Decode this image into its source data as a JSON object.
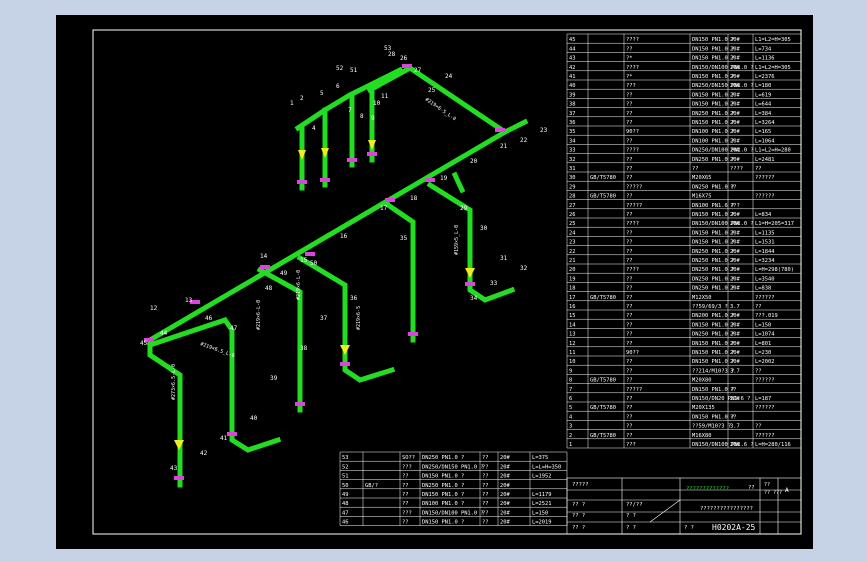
{
  "title_block": {
    "drawing_no": "H0202A-25",
    "row1": [
      "??",
      "??",
      "??\n???",
      "A"
    ],
    "row2": [
      "?? ?",
      "??/??",
      "????????????????"
    ],
    "row3": [
      "?? ?",
      "? ?"
    ],
    "row4": [
      "?? ?",
      "? ?",
      "? ?"
    ],
    "green_label": "?????????????",
    "left_cell": "?????"
  },
  "right_table": [
    [
      "45",
      "",
      "????",
      "DN150 PN1.0 ?",
      "20#",
      "L1=L2=H=305"
    ],
    [
      "44",
      "",
      "??",
      "DN150 PN1.0 ?",
      "20#",
      "L=734"
    ],
    [
      "43",
      "",
      "?*",
      "DN150 PN1.0 ?",
      "20#",
      "L=1136"
    ],
    [
      "42",
      "",
      "????",
      "DN150/DN100 PN1.0 ?",
      "20#",
      "L1=L2=H=305"
    ],
    [
      "41",
      "",
      "?*",
      "DN150 PN1.0 ?",
      "20#",
      "L=2376"
    ],
    [
      "40",
      "",
      "???",
      "DN250/DN150 PN1.0 ?",
      "20#",
      "L=180"
    ],
    [
      "39",
      "",
      "??",
      "DN150 PN1.0 ?",
      "20#",
      "L=619"
    ],
    [
      "38",
      "",
      "??",
      "DN150 PN1.0 ?",
      "20#",
      "L=644"
    ],
    [
      "37",
      "",
      "??",
      "DN250 PN1.0 ?",
      "20#",
      "L=384"
    ],
    [
      "36",
      "",
      "??",
      "DN150 PN1.0 ?",
      "20#",
      "L=3264"
    ],
    [
      "35",
      "",
      "90??",
      "DN100 PN1.0 ?",
      "20#",
      "L=165"
    ],
    [
      "34",
      "",
      "??",
      "DN100 PN1.0 ?",
      "20#",
      "L=1064"
    ],
    [
      "33",
      "",
      "????",
      "DN250/DN100 PN1.0 ?",
      "20#",
      "L1=L2=H=280"
    ],
    [
      "32",
      "",
      "??",
      "DN250 PN1.0 ?",
      "20#",
      "L=2481"
    ],
    [
      "31",
      "",
      "??",
      "??",
      "????",
      "??"
    ],
    [
      "30",
      "GB/T5780",
      "??",
      "M20X65",
      "",
      "4.8",
      "??????"
    ],
    [
      "29",
      "",
      "?????",
      "DN250 PN1.0 ?",
      "??",
      ""
    ],
    [
      "28",
      "GB/T5780",
      "??",
      "M16X75",
      "",
      "4.8",
      "??????"
    ],
    [
      "27",
      "",
      "?????",
      "DN100 PN1.6 ?",
      "???",
      ""
    ],
    [
      "26",
      "",
      "??",
      "DN150 PN1.0 ?",
      "20#",
      "L=834"
    ],
    [
      "25",
      "",
      "????",
      "DN150/DN100 PN1.0 ?",
      "20#",
      "L1=H=205=317"
    ],
    [
      "24",
      "",
      "??",
      "DN150 PN1.0 ?",
      "20#",
      "L=1135"
    ],
    [
      "23",
      "",
      "??",
      "DN150 PN1.0 ?",
      "20#",
      "L=1531"
    ],
    [
      "22",
      "",
      "??",
      "DN250 PN1.0 ?",
      "20#",
      "L=1844"
    ],
    [
      "21",
      "",
      "??",
      "DN250 PN1.0 ?",
      "20#",
      "L=3234"
    ],
    [
      "20",
      "",
      "????",
      "DN250 PN1.0 ?",
      "20#",
      "L=H=298(780)"
    ],
    [
      "19",
      "",
      "??",
      "DN250 PN1.0 ?",
      "20#",
      "L=3540"
    ],
    [
      "18",
      "",
      "??",
      "DN250 PN1.0 ?",
      "20#",
      "L=838"
    ],
    [
      "17",
      "GB/T5780",
      "??",
      "M12X50",
      "",
      "4.8",
      "??????"
    ],
    [
      "16",
      "",
      "??",
      "??59/69/3 ?",
      "3.7",
      "??"
    ],
    [
      "15",
      "",
      "??",
      "DN200 PN1.0 ?",
      "20#",
      "???.019"
    ],
    [
      "14",
      "",
      "??",
      "DN150 PN1.0 ?",
      "20#",
      "L=150"
    ],
    [
      "13",
      "",
      "??",
      "DN250 PN1.0 ?",
      "20#",
      "L=1074"
    ],
    [
      "12",
      "",
      "??",
      "DN150 PN1.0 ?",
      "20#",
      "L=801"
    ],
    [
      "11",
      "",
      "90??",
      "DN150 PN1.0 ?",
      "20#",
      "L=230"
    ],
    [
      "10",
      "",
      "??",
      "DN150 PN1.0 ?",
      "20#",
      "L=2002"
    ],
    [
      "9",
      "",
      "??",
      "??214/M10?3 ?",
      "3.7",
      "??"
    ],
    [
      "8",
      "GB/T5780",
      "??",
      "M20X80",
      "",
      "4.8",
      "??????"
    ],
    [
      "7",
      "",
      "?????",
      "DN150 PN1.0 ?",
      "??",
      ""
    ],
    [
      "6",
      "",
      "??",
      "DN150/DN20 PN1.6 ?",
      "20#",
      "L=187"
    ],
    [
      "5",
      "GB/T5780",
      "??",
      "M20X135",
      "",
      "4.8",
      "??????"
    ],
    [
      "4",
      "",
      "??",
      "DN150 PN1.0 ?",
      "??",
      ""
    ],
    [
      "3",
      "",
      "??",
      "??59/M10?3 ?",
      "3.7",
      "??"
    ],
    [
      "2",
      "GB/T5780",
      "??",
      "M16X80",
      "",
      "4.8",
      "??????"
    ],
    [
      "1",
      "",
      "???",
      "DN150/DN100 PN1.6 ?",
      "20#",
      "L=H=280/116"
    ]
  ],
  "bottom_table": [
    [
      "53",
      "",
      "SO??",
      "DN250 PN1.0 ?",
      "??",
      "20#",
      "L=375"
    ],
    [
      "52",
      "",
      "???",
      "DN250/DN150 PN1.0 ?",
      "??",
      "20#",
      "L=L=H=350"
    ],
    [
      "51",
      "",
      "??",
      "DN150 PN1.0 ?",
      "??",
      "20#",
      "L=1952"
    ],
    [
      "50",
      "GB/?",
      "??",
      "DN250 PN1.0 ?",
      "??",
      "20#",
      ""
    ],
    [
      "49",
      "",
      "??",
      "DN150 PN1.0 ?",
      "??",
      "20#",
      "L=1179"
    ],
    [
      "48",
      "",
      "??",
      "DN100 PN1.0 ?",
      "??",
      "20#",
      "L=2521"
    ],
    [
      "47",
      "",
      "???",
      "DN150/DN100 PN1.0 ?",
      "??",
      "20#",
      "L=150"
    ],
    [
      "46",
      "",
      "??",
      "DN150 PN1.0 ?",
      "??",
      "20#",
      "L=2019"
    ]
  ],
  "callouts": [
    "53",
    "52",
    "51",
    "1",
    "2",
    "4",
    "5",
    "6",
    "7",
    "8",
    "9",
    "10",
    "11",
    "12",
    "13",
    "14",
    "15",
    "16",
    "17",
    "18",
    "19",
    "20",
    "21",
    "22",
    "23",
    "24",
    "25",
    "26",
    "27",
    "28",
    "29",
    "30",
    "31",
    "32",
    "33",
    "34",
    "35",
    "36",
    "37",
    "38",
    "39",
    "40",
    "41",
    "42",
    "43",
    "44",
    "45",
    "46",
    "47",
    "48",
    "49",
    "50"
  ],
  "pipe_labels": [
    "#219×6-5_L-0",
    "#273×6.5-L-0",
    "#219×6-L-0",
    "#219×6-5",
    "#159×5_L-0",
    "#219×6.5_L-0",
    "#219×6-L-0"
  ],
  "colors": {
    "pipe": "#22dd22",
    "frame": "#ffffff",
    "background": "#000000",
    "flange": "#dd44dd",
    "valve": "#eeee22"
  }
}
